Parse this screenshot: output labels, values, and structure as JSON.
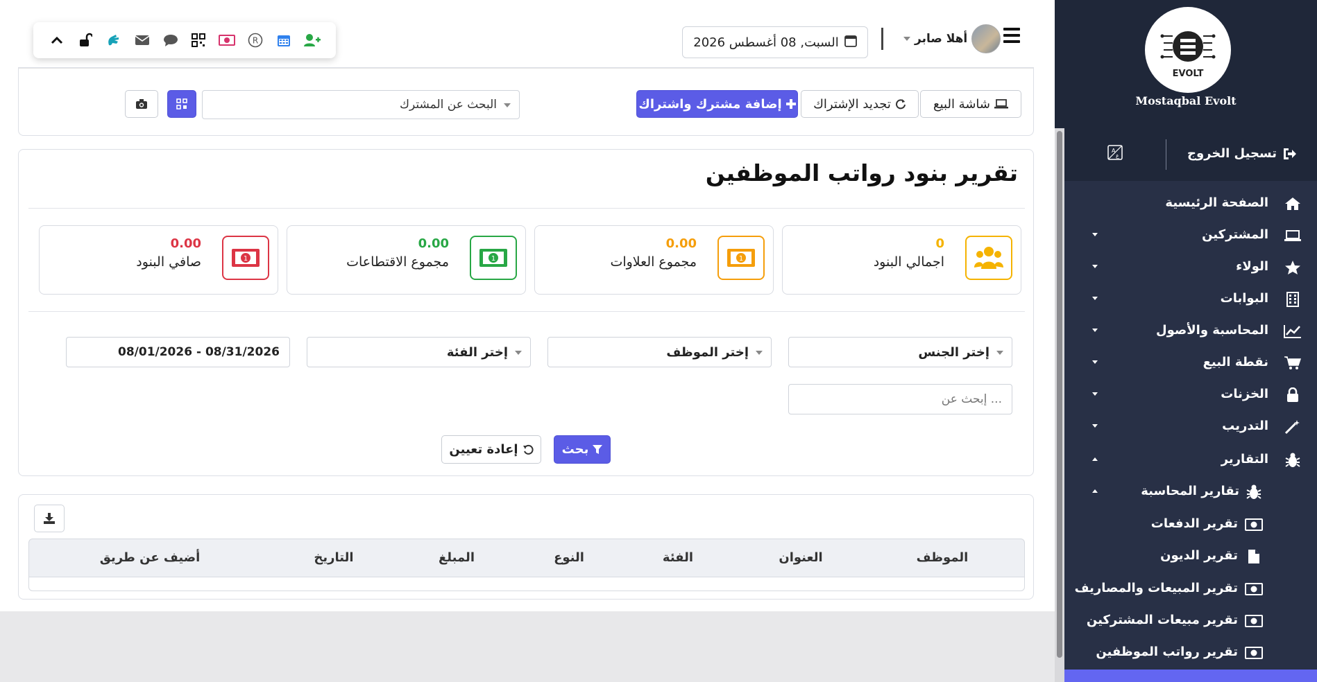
{
  "colors": {
    "primary": "#5b5ce6",
    "sidebar_bg": "#283046",
    "stat_yellow": "#f5b301",
    "stat_orange": "#f59e0b",
    "stat_green": "#28a745",
    "stat_red": "#dc3545"
  },
  "toolbar": {
    "icons": [
      "add-user-icon",
      "calendar-icon",
      "registered-icon",
      "money-icon",
      "qrcode-icon",
      "chat-icon",
      "envelope-icon",
      "sign-language-icon",
      "unlock-icon",
      "chevron-up-icon"
    ]
  },
  "header": {
    "date": "السبت, 08 أغسطس 2026",
    "greeting": "أهلا صابر"
  },
  "actions": {
    "pos_screen": "شاشة البيع",
    "renew_subscription": "تجديد الإشتراك",
    "add_subscriber": "إضافة مشترك واشتراك",
    "search_subscriber": "البحث عن المشترك"
  },
  "report": {
    "title": "تقرير بنود رواتب الموظفين",
    "stats": [
      {
        "label": "اجمالي البنود",
        "value": "0",
        "icon": "users-icon"
      },
      {
        "label": "مجموع العلاوات",
        "value": "0.00",
        "icon": "money-icon"
      },
      {
        "label": "مجموع الاقتطاعات",
        "value": "0.00",
        "icon": "money-icon"
      },
      {
        "label": "صافي البنود",
        "value": "0.00",
        "icon": "money-icon"
      }
    ],
    "filters": {
      "gender": "إختر الجنس",
      "employee": "إختر الموظف",
      "category": "إختر الفئة",
      "date_range": "08/01/2026 - 08/31/2026",
      "search_placeholder": "إبحث عن ..."
    },
    "search_button": "بحث",
    "reset_button": "إعادة تعيين"
  },
  "table": {
    "columns": [
      "الموظف",
      "العنوان",
      "الفئة",
      "النوع",
      "المبلغ",
      "التاريخ",
      "أضيف عن طريق"
    ]
  },
  "sidebar": {
    "brand": "Mostaqbal Evolt",
    "logo_text": "EVOLT",
    "logout": "تسجيل الخروج",
    "items": [
      {
        "label": "الصفحة الرئيسية",
        "icon": "home-icon",
        "arrow": "none"
      },
      {
        "label": "المشتركين",
        "icon": "laptop-icon",
        "arrow": "down"
      },
      {
        "label": "الولاء",
        "icon": "star-icon",
        "arrow": "down"
      },
      {
        "label": "البوابات",
        "icon": "building-icon",
        "arrow": "down"
      },
      {
        "label": "المحاسبة والأصول",
        "icon": "chart-line-icon",
        "arrow": "down"
      },
      {
        "label": "نقطة البيع",
        "icon": "cart-icon",
        "arrow": "down"
      },
      {
        "label": "الخزنات",
        "icon": "lock-icon",
        "arrow": "down"
      },
      {
        "label": "التدريب",
        "icon": "magic-wand-icon",
        "arrow": "down"
      },
      {
        "label": "التقارير",
        "icon": "bug-icon",
        "arrow": "up"
      }
    ],
    "sub_group": {
      "label": "تقارير المحاسبة",
      "icon": "bug-icon",
      "arrow": "up"
    },
    "sub_items": [
      {
        "label": "تقرير الدفعات",
        "icon": "money-icon"
      },
      {
        "label": "تقرير الديون",
        "icon": "file-icon"
      },
      {
        "label": "تقرير المبيعات والمصاريف",
        "icon": "money-icon"
      },
      {
        "label": "تقرير مبيعات المشتركين",
        "icon": "money-icon"
      },
      {
        "label": "تقرير رواتب الموظفين",
        "icon": "money-icon"
      }
    ]
  }
}
